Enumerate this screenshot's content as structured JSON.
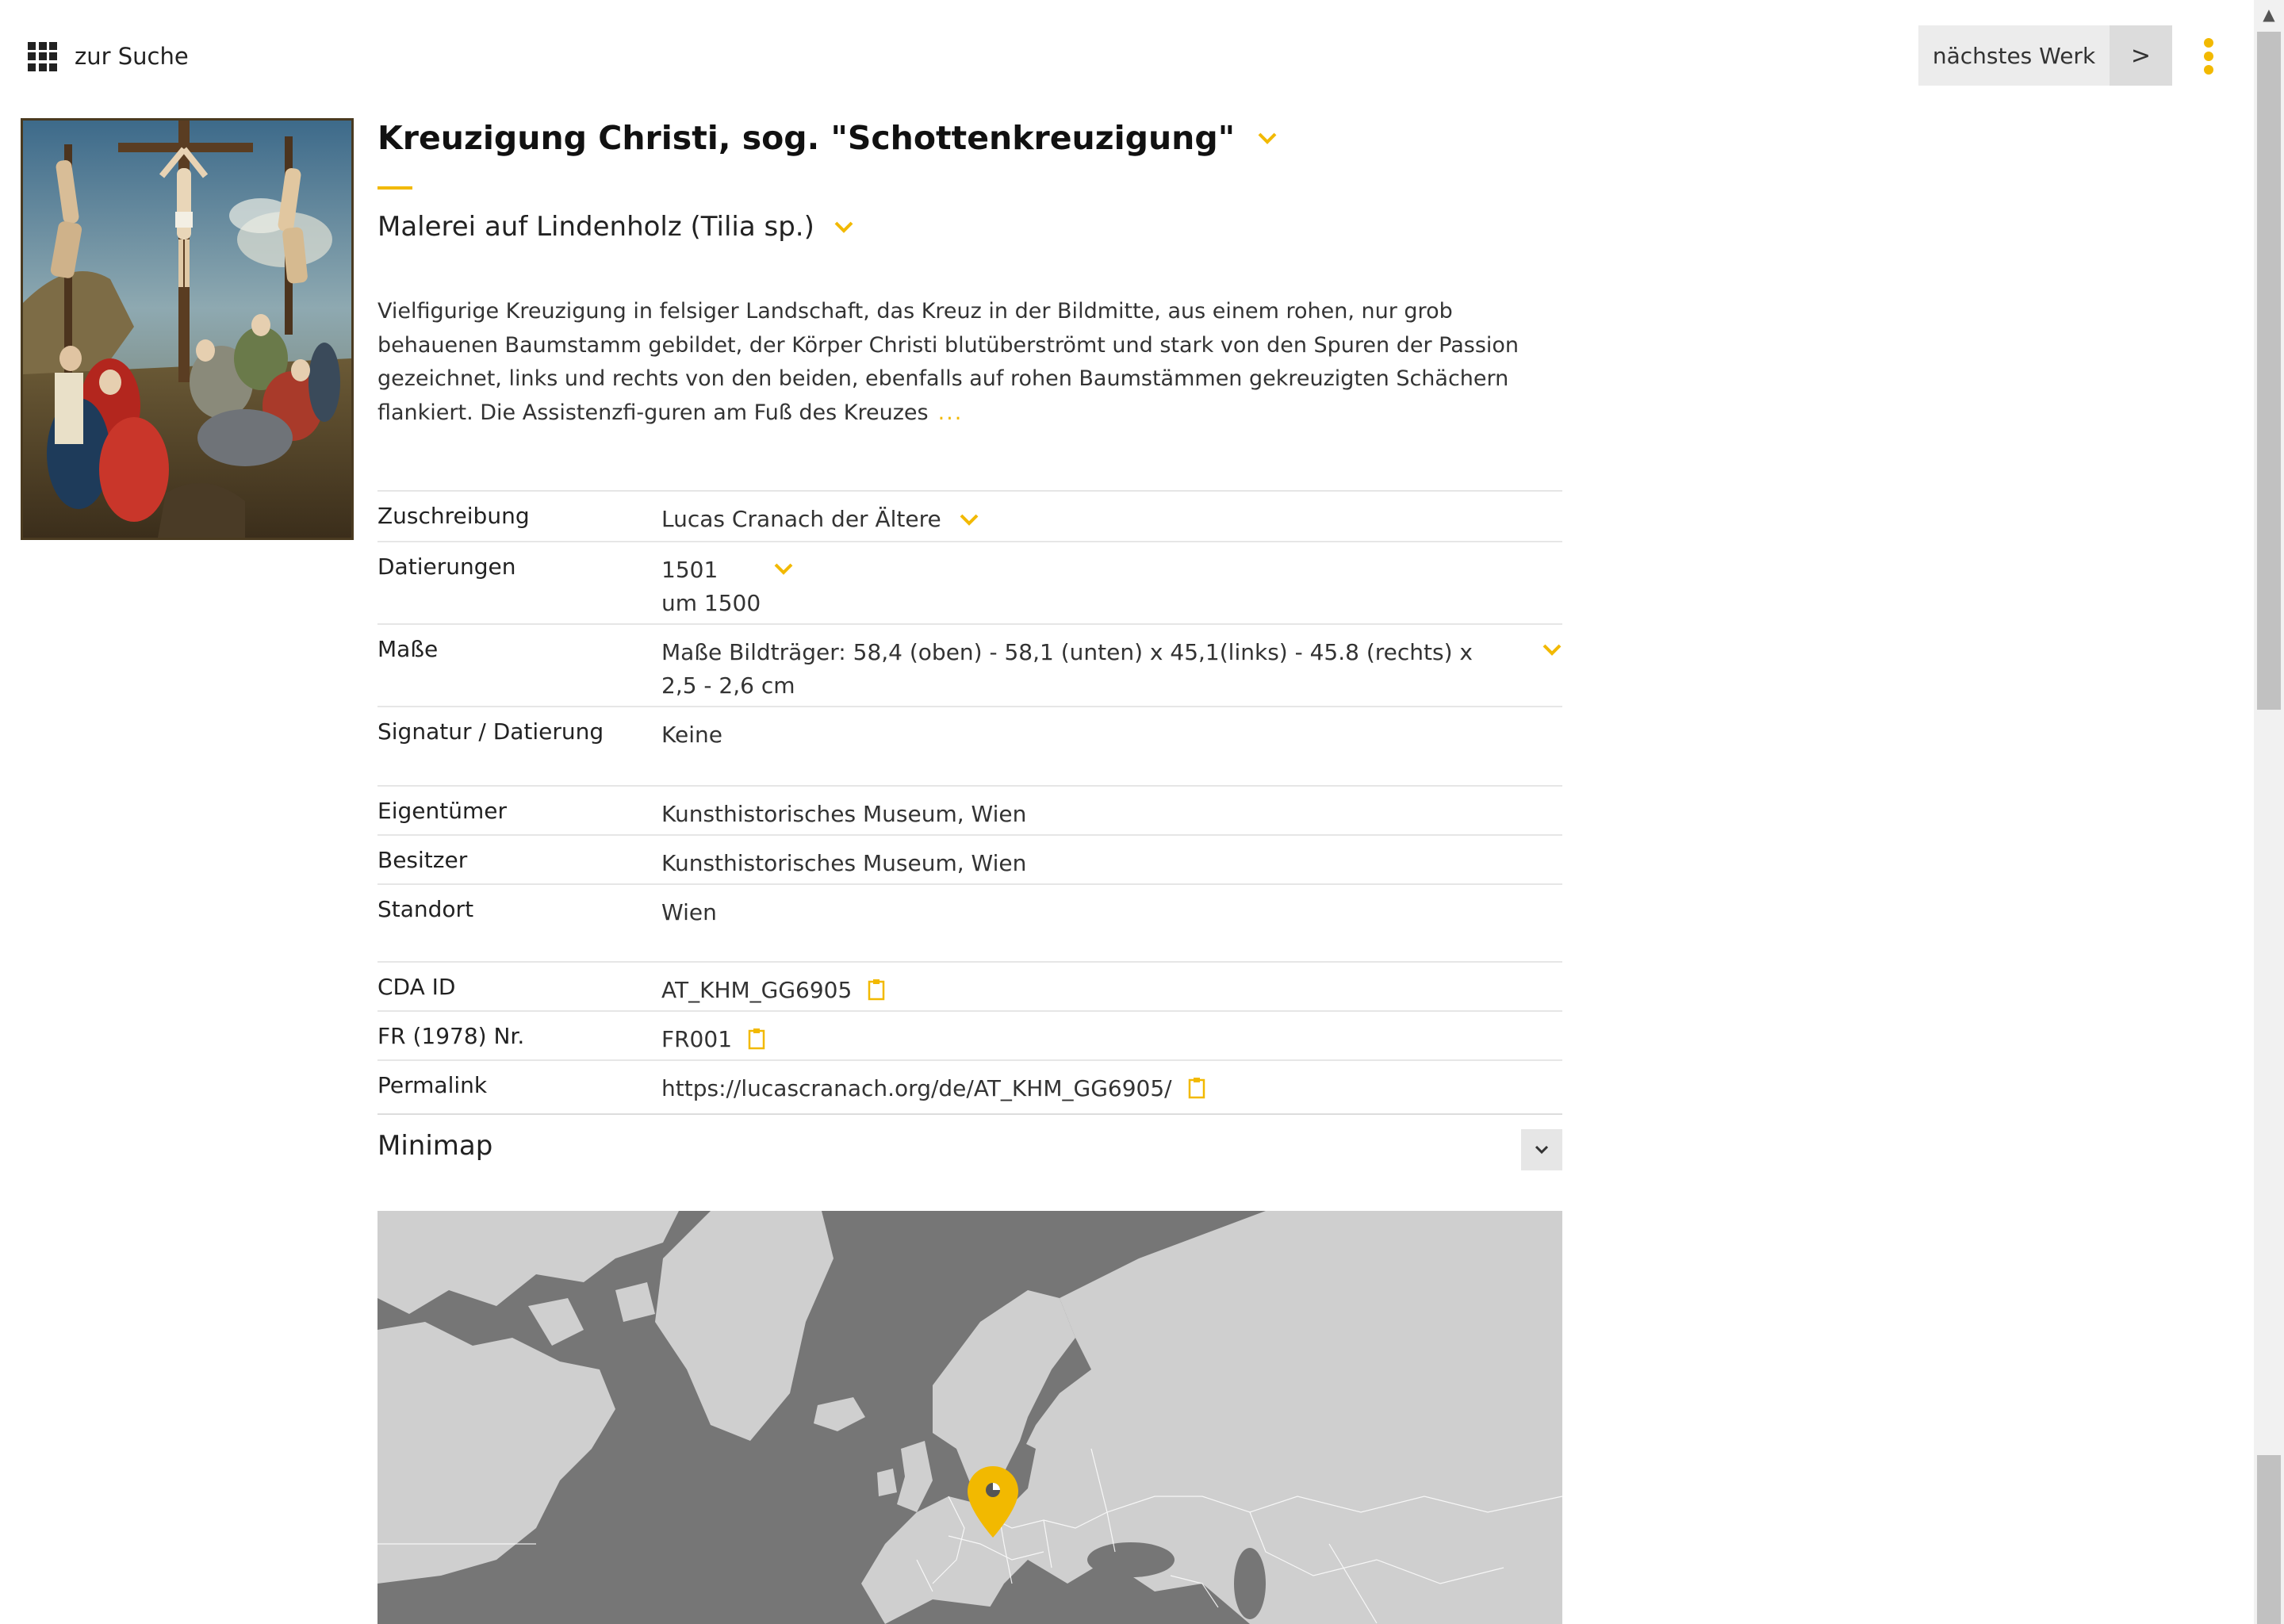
{
  "nav": {
    "back_label": "zur Suche",
    "next_label": "nächstes Werk",
    "next_arrow": ">"
  },
  "artwork": {
    "title": "Kreuzigung Christi, sog. \"Schottenkreuzigung\"",
    "medium": "Malerei auf Lindenholz (Tilia sp.)",
    "description": "Vielfigurige Kreuzigung in felsiger Landschaft, das Kreuz in der Bildmitte, aus einem rohen, nur grob behauenen Baumstamm gebildet, der Körper Christi blutüberströmt und stark von den Spuren der Passion gezeichnet, links und rechts von den beiden, ebenfalls auf rohen Baumstämmen gekreuzigten Schächern flankiert. Die Assistenzfi-guren am Fuß des Kreuzes",
    "description_more": "...",
    "image_alt": "Gemälde Kreuzigung Christi"
  },
  "facts": {
    "attribution_label": "Zuschreibung",
    "attribution_value": "Lucas Cranach der Ältere",
    "dating_label": "Datierungen",
    "dating_value_1": "1501",
    "dating_value_2": "um 1500",
    "dimensions_label": "Maße",
    "dimensions_value": "Maße Bildträger: 58,4 (oben) - 58,1 (unten) x 45,1(links) - 45.8 (rechts) x 2,5 - 2,6 cm",
    "signature_label": "Signatur / Datierung",
    "signature_value": "Keine",
    "owner_label": "Eigentümer",
    "owner_value": "Kunsthistorisches Museum, Wien",
    "holder_label": "Besitzer",
    "holder_value": "Kunsthistorisches Museum, Wien",
    "location_label": "Standort",
    "location_value": "Wien",
    "cda_label": "CDA ID",
    "cda_value": "AT_KHM_GG6905",
    "fr_label": "FR (1978) Nr.",
    "fr_value": "FR001",
    "permalink_label": "Permalink",
    "permalink_value": "https://lucascranach.org/de/AT_KHM_GG6905/"
  },
  "minimap": {
    "label": "Minimap",
    "marker_location": "Wien"
  },
  "colors": {
    "accent": "#f2b900",
    "map_water": "#767676",
    "map_land": "#cfcfcf"
  },
  "icons": {
    "grid": "grid-icon",
    "chevron": "chevron-down-icon",
    "clipboard": "clipboard-icon",
    "kebab": "kebab-menu-icon",
    "marker": "map-marker-icon"
  }
}
